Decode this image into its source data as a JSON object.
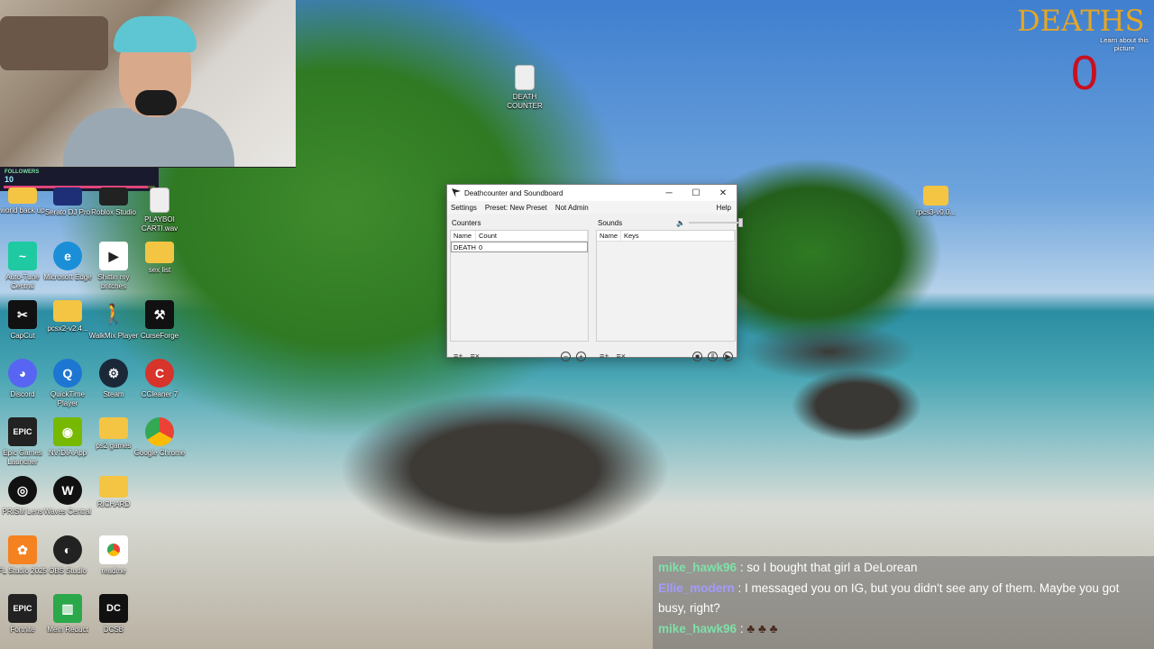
{
  "webcam": {
    "followers_label": "FOLLOWERS",
    "followers_count": "10",
    "followers_progress": 0.95
  },
  "deaths": {
    "title": "DEATHS",
    "count": "0"
  },
  "learn_about": "Learn about this picture",
  "desktop_icons": {
    "death_counter": "DEATH COUNTER",
    "pcsx3": "rpcs3-v0.0...",
    "world_back_up": "world back up",
    "serato": "Serato DJ Pro",
    "roblox": "Roblox Studio",
    "playboi": "PLAYBOI CARTI.wav",
    "autotune": "Auto-Tune Central",
    "edge": "Microsoft Edge",
    "shittin": "Shittin my britches",
    "sex_list": "sex list",
    "capcut": "CapCut",
    "pcsx2": "pcsx2-v2.4...",
    "walkmix": "WalkMix Player",
    "curseforge": "CurseForge",
    "discord": "Discord",
    "quicktime": "QuickTime Player",
    "steam": "Steam",
    "ccleaner": "CCleaner 7",
    "epic": "Epic Games Launcher",
    "nvidia": "NVIDIA App",
    "ps2games": "ps2 games",
    "chrome": "Google Chrome",
    "prism": "PRISM Lens",
    "waves": "Waves Central",
    "richard": "RICHARD",
    "flstudio": "FL Studio 2025",
    "obs": "OBS Studio",
    "readme": "readme",
    "fortnite": "Fortnite",
    "memreduct": "Mem Reduct",
    "dcsb": "DCSB"
  },
  "app": {
    "title": "Deathcounter and Soundboard",
    "menu": {
      "settings": "Settings",
      "preset": "Preset: New Preset",
      "admin": "Not Admin",
      "help": "Help"
    },
    "counters": {
      "label": "Counters",
      "col_name": "Name",
      "col_count": "Count",
      "rows": [
        {
          "name": "DEATH",
          "count": "0"
        }
      ]
    },
    "sounds": {
      "label": "Sounds",
      "col_name": "Name",
      "col_keys": "Keys",
      "volume_level": 1.0
    }
  },
  "chat": [
    {
      "user": "mike_hawk96",
      "color": "#7fe0a8",
      "text": ": so I bought that girl a DeLorean"
    },
    {
      "user": "Ellie_modern",
      "color": "#a29bfe",
      "text": ": I messaged you on IG, but you didn't see any of them. Maybe you got busy, right?"
    },
    {
      "user": "mike_hawk96",
      "color": "#7fe0a8",
      "text": ":"
    }
  ]
}
